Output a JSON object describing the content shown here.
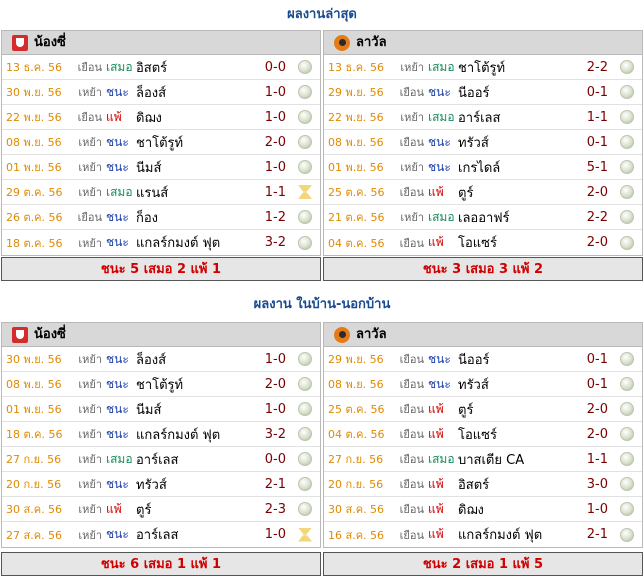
{
  "latest": {
    "title": "ผลงานล่าสุด",
    "left": {
      "team": "น้องซี่",
      "rows": [
        {
          "date": "13 ธ.ค. 56",
          "venue": "เยือน",
          "result": "เสมอ",
          "type": "draw",
          "opponent": "อิสตร์",
          "score": "0-0",
          "icon": "ball"
        },
        {
          "date": "30 พ.ย. 56",
          "venue": "เหย้า",
          "result": "ชนะ",
          "type": "win",
          "opponent": "ล็องส์",
          "score": "1-0",
          "icon": "ball"
        },
        {
          "date": "22 พ.ย. 56",
          "venue": "เยือน",
          "result": "แพ้",
          "type": "loss",
          "opponent": "ดิฌง",
          "score": "1-0",
          "icon": "ball"
        },
        {
          "date": "08 พ.ย. 56",
          "venue": "เหย้า",
          "result": "ชนะ",
          "type": "win",
          "opponent": "ชาโต้รูท์",
          "score": "2-0",
          "icon": "ball"
        },
        {
          "date": "01 พ.ย. 56",
          "venue": "เหย้า",
          "result": "ชนะ",
          "type": "win",
          "opponent": "นีมส์",
          "score": "1-0",
          "icon": "ball"
        },
        {
          "date": "29 ต.ค. 56",
          "venue": "เหย้า",
          "result": "เสมอ",
          "type": "draw",
          "opponent": "แรนส์",
          "score": "1-1",
          "icon": "hourglass"
        },
        {
          "date": "26 ต.ค. 56",
          "venue": "เยือน",
          "result": "ชนะ",
          "type": "win",
          "opponent": "ก็อง",
          "score": "1-2",
          "icon": "ball"
        },
        {
          "date": "18 ต.ค. 56",
          "venue": "เหย้า",
          "result": "ชนะ",
          "type": "win",
          "opponent": "แกลร์กมงต์ ฟุต",
          "score": "3-2",
          "icon": "ball"
        }
      ],
      "summary": "ชนะ 5 เสมอ 2 แพ้ 1"
    },
    "right": {
      "team": "ลาวัล",
      "rows": [
        {
          "date": "13 ธ.ค. 56",
          "venue": "เหย้า",
          "result": "เสมอ",
          "type": "draw",
          "opponent": "ชาโต้รูท์",
          "score": "2-2",
          "icon": "ball"
        },
        {
          "date": "29 พ.ย. 56",
          "venue": "เยือน",
          "result": "ชนะ",
          "type": "win",
          "opponent": "นีออร์",
          "score": "0-1",
          "icon": "ball"
        },
        {
          "date": "22 พ.ย. 56",
          "venue": "เหย้า",
          "result": "เสมอ",
          "type": "draw",
          "opponent": "อาร์เลส",
          "score": "1-1",
          "icon": "ball"
        },
        {
          "date": "08 พ.ย. 56",
          "venue": "เยือน",
          "result": "ชนะ",
          "type": "win",
          "opponent": "ทรัวส์",
          "score": "0-1",
          "icon": "ball"
        },
        {
          "date": "01 พ.ย. 56",
          "venue": "เหย้า",
          "result": "ชนะ",
          "type": "win",
          "opponent": "เกรไดล์",
          "score": "5-1",
          "icon": "ball"
        },
        {
          "date": "25 ต.ค. 56",
          "venue": "เยือน",
          "result": "แพ้",
          "type": "loss",
          "opponent": "ตูร์",
          "score": "2-0",
          "icon": "ball"
        },
        {
          "date": "21 ต.ค. 56",
          "venue": "เหย้า",
          "result": "เสมอ",
          "type": "draw",
          "opponent": "เลออาฟร์",
          "score": "2-2",
          "icon": "ball"
        },
        {
          "date": "04 ต.ค. 56",
          "venue": "เยือน",
          "result": "แพ้",
          "type": "loss",
          "opponent": "โอแซร์",
          "score": "2-0",
          "icon": "ball"
        }
      ],
      "summary": "ชนะ 3 เสมอ 3 แพ้ 2"
    }
  },
  "homeaway": {
    "title": "ผลงาน ในบ้าน-นอกบ้าน",
    "left": {
      "team": "น้องซี่",
      "rows": [
        {
          "date": "30 พ.ย. 56",
          "venue": "เหย้า",
          "result": "ชนะ",
          "type": "win",
          "opponent": "ล็องส์",
          "score": "1-0",
          "icon": "ball"
        },
        {
          "date": "08 พ.ย. 56",
          "venue": "เหย้า",
          "result": "ชนะ",
          "type": "win",
          "opponent": "ชาโต้รูท์",
          "score": "2-0",
          "icon": "ball"
        },
        {
          "date": "01 พ.ย. 56",
          "venue": "เหย้า",
          "result": "ชนะ",
          "type": "win",
          "opponent": "นีมส์",
          "score": "1-0",
          "icon": "ball"
        },
        {
          "date": "18 ต.ค. 56",
          "venue": "เหย้า",
          "result": "ชนะ",
          "type": "win",
          "opponent": "แกลร์กมงต์ ฟุต",
          "score": "3-2",
          "icon": "ball"
        },
        {
          "date": "27 ก.ย. 56",
          "venue": "เหย้า",
          "result": "เสมอ",
          "type": "draw",
          "opponent": "อาร์เลส",
          "score": "0-0",
          "icon": "ball"
        },
        {
          "date": "20 ก.ย. 56",
          "venue": "เหย้า",
          "result": "ชนะ",
          "type": "win",
          "opponent": "ทรัวส์",
          "score": "2-1",
          "icon": "ball"
        },
        {
          "date": "30 ส.ค. 56",
          "venue": "เหย้า",
          "result": "แพ้",
          "type": "loss",
          "opponent": "ตูร์",
          "score": "2-3",
          "icon": "ball"
        },
        {
          "date": "27 ส.ค. 56",
          "venue": "เหย้า",
          "result": "ชนะ",
          "type": "win",
          "opponent": "อาร์เลส",
          "score": "1-0",
          "icon": "hourglass"
        }
      ],
      "summary": "ชนะ 6 เสมอ 1 แพ้ 1"
    },
    "right": {
      "team": "ลาวัล",
      "rows": [
        {
          "date": "29 พ.ย. 56",
          "venue": "เยือน",
          "result": "ชนะ",
          "type": "win",
          "opponent": "นีออร์",
          "score": "0-1",
          "icon": "ball"
        },
        {
          "date": "08 พ.ย. 56",
          "venue": "เยือน",
          "result": "ชนะ",
          "type": "win",
          "opponent": "ทรัวส์",
          "score": "0-1",
          "icon": "ball"
        },
        {
          "date": "25 ต.ค. 56",
          "venue": "เยือน",
          "result": "แพ้",
          "type": "loss",
          "opponent": "ตูร์",
          "score": "2-0",
          "icon": "ball"
        },
        {
          "date": "04 ต.ค. 56",
          "venue": "เยือน",
          "result": "แพ้",
          "type": "loss",
          "opponent": "โอแซร์",
          "score": "2-0",
          "icon": "ball"
        },
        {
          "date": "27 ก.ย. 56",
          "venue": "เยือน",
          "result": "เสมอ",
          "type": "draw",
          "opponent": "บาสเตีย CA",
          "score": "1-1",
          "icon": "ball"
        },
        {
          "date": "20 ก.ย. 56",
          "venue": "เยือน",
          "result": "แพ้",
          "type": "loss",
          "opponent": "อิสตร์",
          "score": "3-0",
          "icon": "ball"
        },
        {
          "date": "30 ส.ค. 56",
          "venue": "เยือน",
          "result": "แพ้",
          "type": "loss",
          "opponent": "ดิฌง",
          "score": "1-0",
          "icon": "ball"
        },
        {
          "date": "16 ส.ค. 56",
          "venue": "เยือน",
          "result": "แพ้",
          "type": "loss",
          "opponent": "แกลร์กมงต์ ฟุต",
          "score": "2-1",
          "icon": "ball"
        }
      ],
      "summary": "ชนะ 2 เสมอ 1 แพ้ 5"
    }
  },
  "colors": {
    "title": "#1a4b8e",
    "date": "#e08a00",
    "win": "#1a3fa8",
    "draw": "#1a8a5a",
    "loss": "#d10000",
    "score": "#7a0000",
    "summary": "#d10000",
    "header_bg": "#d8d8d8"
  },
  "logos": {
    "left_team": "red-shield-logo",
    "right_team": "orange-tiger-logo"
  }
}
